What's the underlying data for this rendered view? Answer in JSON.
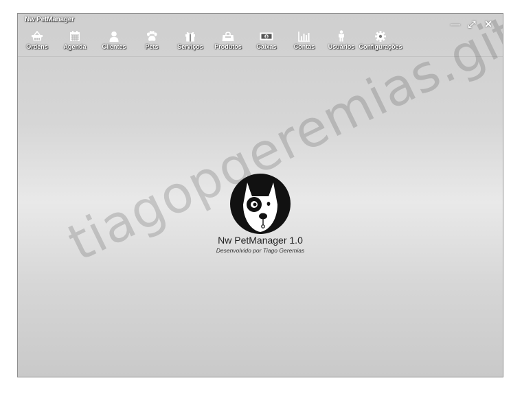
{
  "window": {
    "title": "Nw PetManager",
    "controls": [
      {
        "name": "minimize",
        "glyph": "—"
      },
      {
        "name": "maximize",
        "glyph": "⤢"
      },
      {
        "name": "close",
        "glyph": "✕"
      }
    ]
  },
  "toolbar": {
    "items": [
      {
        "label": "Ordens",
        "icon": "basket-icon"
      },
      {
        "label": "Agenda",
        "icon": "calendar-icon"
      },
      {
        "label": "Clientes",
        "icon": "user-icon"
      },
      {
        "label": "Pets",
        "icon": "paw-icon"
      },
      {
        "label": "Serviços",
        "icon": "gift-icon"
      },
      {
        "label": "Produtos",
        "icon": "shopping-bag-icon"
      },
      {
        "label": "Caixas",
        "icon": "money-icon"
      },
      {
        "label": "Contas",
        "icon": "bar-chart-icon"
      },
      {
        "label": "Usuários",
        "icon": "person-icon"
      },
      {
        "label": "Configurações",
        "icon": "gear-icon"
      }
    ]
  },
  "splash": {
    "product_name": "Nw PetManager 1.0",
    "credit": "Desenvolvido por Tiago Geremias"
  },
  "watermark": "tiagopgeremias.github.io",
  "colors": {
    "background_light": "#e9e9e9",
    "background_dark": "#c9c9c9",
    "text_white": "#ffffff",
    "text_dark": "#222222"
  }
}
